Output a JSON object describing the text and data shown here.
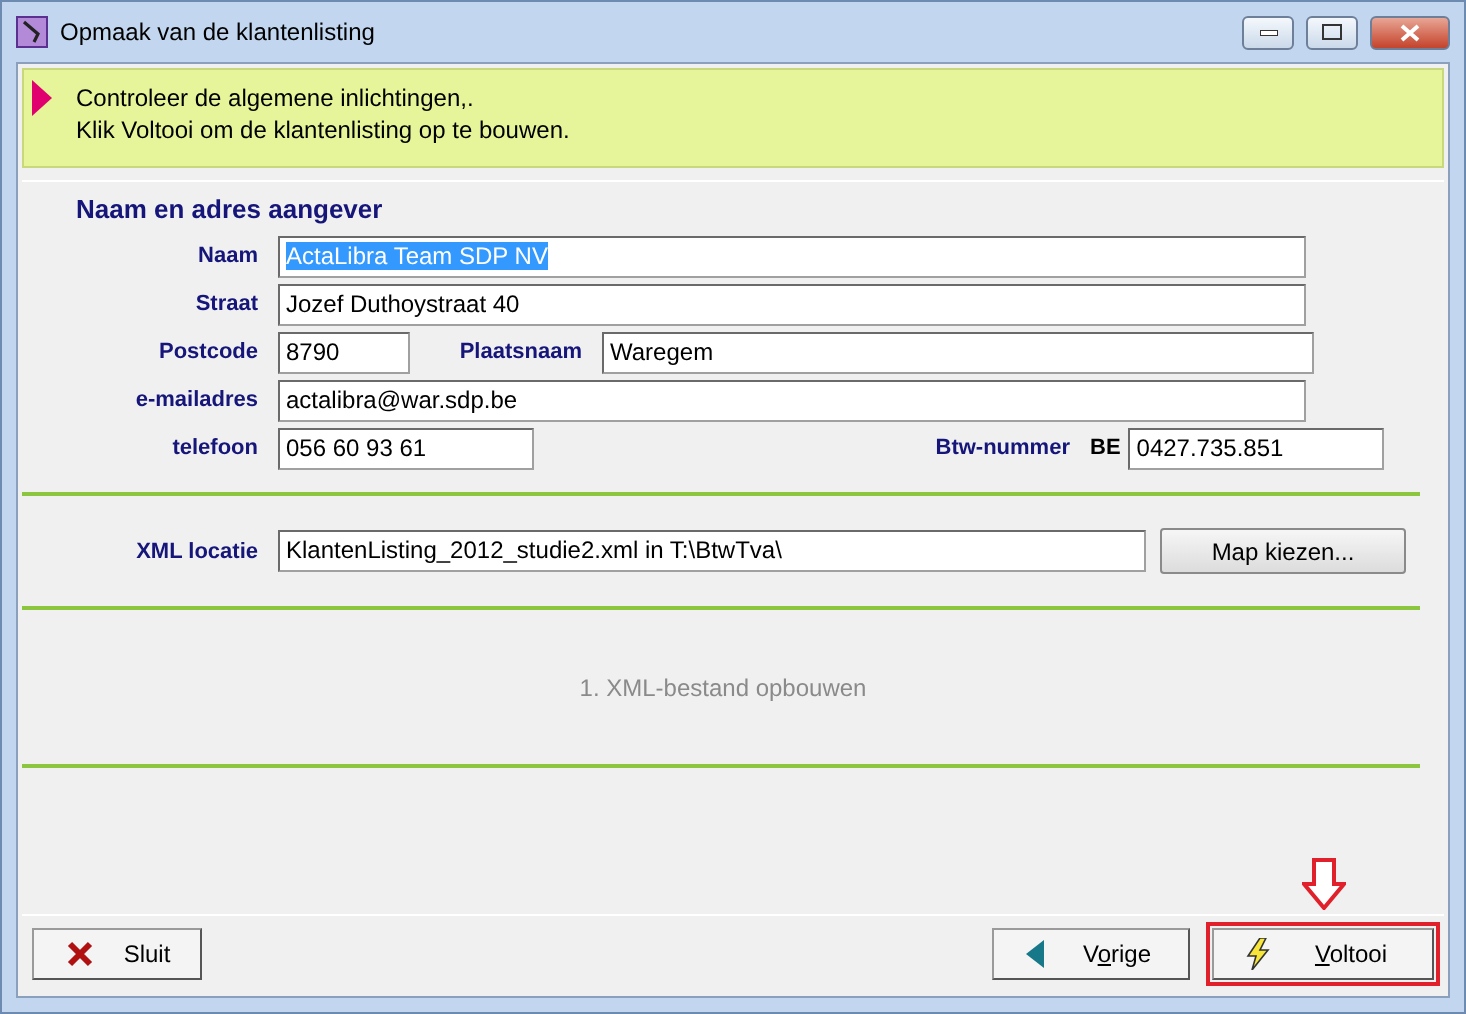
{
  "window": {
    "title": "Opmaak van de klantenlisting"
  },
  "banner": {
    "lines": [
      "Controleer de algemene inlichtingen,.",
      "Klik Voltooi om de klantenlisting op te bouwen."
    ]
  },
  "section": {
    "title": "Naam en adres aangever"
  },
  "rows": [
    {
      "fields": [
        {
          "label": "Naam",
          "value": "ActaLibra Team SDP NV",
          "selected": true
        }
      ]
    },
    {
      "fields": [
        {
          "label": "Straat",
          "value": "Jozef Duthoystraat 40",
          "selected": false
        }
      ]
    },
    {
      "fields": [
        {
          "label": "Postcode",
          "value": "8790",
          "selected": false
        },
        {
          "label": "Plaatsnaam",
          "value": "Waregem",
          "selected": false
        }
      ]
    },
    {
      "fields": [
        {
          "label": "e-mailadres",
          "value": "actalibra@war.sdp.be",
          "selected": false
        }
      ]
    },
    {
      "fields": [
        {
          "label": "telefoon",
          "value": "056 60 93 61",
          "selected": false
        },
        {
          "label": "Btw-nummer",
          "prefix": "BE",
          "value": "0427.735.851",
          "selected": false
        }
      ]
    }
  ],
  "xml": {
    "label": "XML locatie",
    "value": "KlantenListing_2012_studie2.xml in T:\\BtwTva\\",
    "button": "Map kiezen..."
  },
  "status": "1. XML-bestand opbouwen",
  "buttons": [
    {
      "kind": "close",
      "parts": [
        {
          "text": "Sluit",
          "underlined": false
        }
      ],
      "highlighted": false
    },
    {
      "kind": "back",
      "parts": [
        {
          "text": "V",
          "underlined": false
        },
        {
          "text": "o",
          "underlined": true
        },
        {
          "text": "rige",
          "underlined": false
        }
      ],
      "highlighted": false
    },
    {
      "kind": "finish",
      "parts": [
        {
          "text": "V",
          "underlined": true
        },
        {
          "text": "oltooi",
          "underlined": false
        }
      ],
      "highlighted": true
    }
  ]
}
